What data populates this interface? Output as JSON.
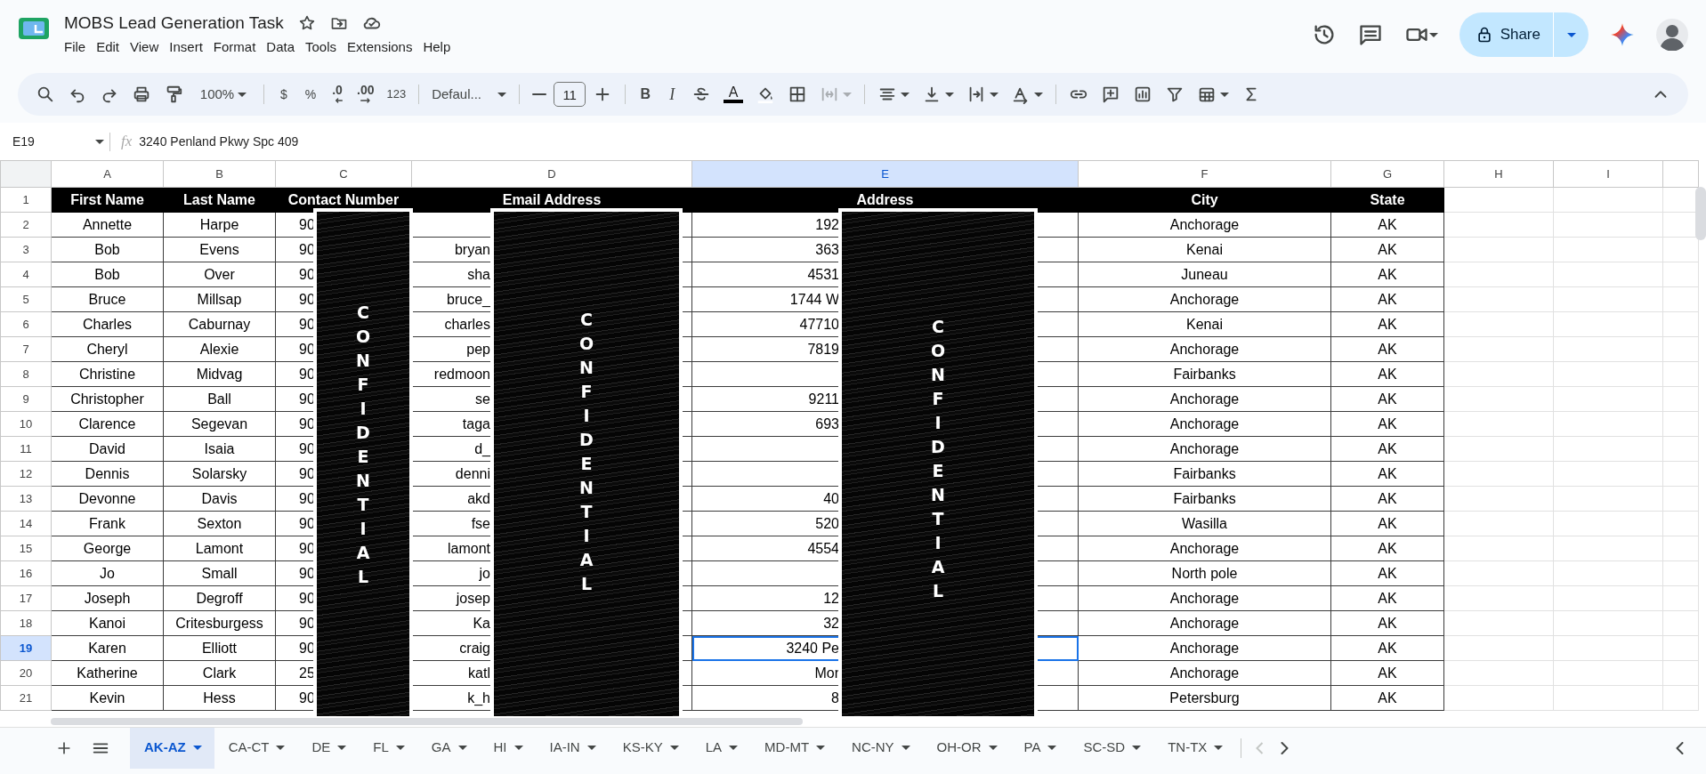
{
  "app": {
    "title": "MOBS Lead Generation Task",
    "menu": [
      "File",
      "Edit",
      "View",
      "Insert",
      "Format",
      "Data",
      "Tools",
      "Extensions",
      "Help"
    ],
    "share": "Share"
  },
  "toolbar": {
    "zoom": "100%",
    "currency": "$",
    "percent": "%",
    "decrease_decimal": ".0",
    "increase_decimal": ".00",
    "number_format": "123",
    "font": "Defaul...",
    "font_size": "11",
    "bold": "B",
    "italic": "I",
    "text_color": "A",
    "merge_disabled": true
  },
  "formula_bar": {
    "cell_ref": "E19",
    "fx": "fx",
    "value": "3240 Penland Pkwy Spc 409"
  },
  "sheet": {
    "header_row": "1",
    "columns": [
      {
        "letter": "A",
        "heading": "First Name",
        "selected": false
      },
      {
        "letter": "B",
        "heading": "Last Name",
        "selected": false
      },
      {
        "letter": "C",
        "heading": "Contact Number",
        "selected": false
      },
      {
        "letter": "D",
        "heading": "Email Address",
        "selected": false
      },
      {
        "letter": "E",
        "heading": "Address",
        "selected": true
      },
      {
        "letter": "F",
        "heading": "City",
        "selected": false
      },
      {
        "letter": "G",
        "heading": "State",
        "selected": false
      },
      {
        "letter": "H",
        "selected": false
      },
      {
        "letter": "I",
        "selected": false
      }
    ],
    "rows": [
      {
        "number": "2",
        "selected": false,
        "cells": {
          "first_name": "Annette",
          "last_name": "Harpe",
          "contact_number": "90",
          "address": "192",
          "city": "Anchorage",
          "state": "AK"
        }
      },
      {
        "number": "3",
        "selected": false,
        "cells": {
          "first_name": "Bob",
          "last_name": "Evens",
          "contact_number": "90",
          "email_address": "bryan",
          "address": "363",
          "city": "Kenai",
          "state": "AK"
        }
      },
      {
        "number": "4",
        "selected": false,
        "cells": {
          "first_name": "Bob",
          "last_name": "Over",
          "contact_number": "90",
          "email_address": "sha",
          "address": "4531",
          "city": "Juneau",
          "state": "AK"
        }
      },
      {
        "number": "5",
        "selected": false,
        "cells": {
          "first_name": "Bruce",
          "last_name": "Millsap",
          "contact_number": "90",
          "email_address": "bruce_",
          "address": "1744 W",
          "city": "Anchorage",
          "state": "AK"
        }
      },
      {
        "number": "6",
        "selected": false,
        "cells": {
          "first_name": "Charles",
          "last_name": "Caburnay",
          "contact_number": "90",
          "email_address": "charles",
          "address": "47710",
          "city": "Kenai",
          "state": "AK"
        }
      },
      {
        "number": "7",
        "selected": false,
        "cells": {
          "first_name": "Cheryl",
          "last_name": "Alexie",
          "contact_number": "90",
          "email_address": "pep",
          "address": "7819",
          "city": "Anchorage",
          "state": "AK"
        }
      },
      {
        "number": "8",
        "selected": false,
        "cells": {
          "first_name": "Christine",
          "last_name": "Midvag",
          "contact_number": "90",
          "email_address": "redmoon",
          "city": "Fairbanks",
          "state": "AK"
        }
      },
      {
        "number": "9",
        "selected": false,
        "cells": {
          "first_name": "Christopher",
          "last_name": "Ball",
          "contact_number": "90",
          "email_address": "se",
          "address": "9211",
          "city": "Anchorage",
          "state": "AK"
        }
      },
      {
        "number": "10",
        "selected": false,
        "cells": {
          "first_name": "Clarence",
          "last_name": "Segevan",
          "contact_number": "90",
          "email_address": "taga",
          "address": "693",
          "city": "Anchorage",
          "state": "AK"
        }
      },
      {
        "number": "11",
        "selected": false,
        "cells": {
          "first_name": "David",
          "last_name": "Isaia",
          "contact_number": "90",
          "email_address": "d_",
          "city": "Anchorage",
          "state": "AK"
        }
      },
      {
        "number": "12",
        "selected": false,
        "cells": {
          "first_name": "Dennis",
          "last_name": "Solarsky",
          "contact_number": "90",
          "email_address": "denni",
          "city": "Fairbanks",
          "state": "AK"
        }
      },
      {
        "number": "13",
        "selected": false,
        "cells": {
          "first_name": "Devonne",
          "last_name": "Davis",
          "contact_number": "90",
          "email_address": "akd",
          "address": "40",
          "city": "Fairbanks",
          "state": "AK"
        }
      },
      {
        "number": "14",
        "selected": false,
        "cells": {
          "first_name": "Frank",
          "last_name": "Sexton",
          "contact_number": "90",
          "email_address": "fse",
          "address": "520",
          "city": "Wasilla",
          "state": "AK"
        }
      },
      {
        "number": "15",
        "selected": false,
        "cells": {
          "first_name": "George",
          "last_name": "Lamont",
          "contact_number": "90",
          "email_address": "lamont",
          "address": "4554",
          "city": "Anchorage",
          "state": "AK"
        }
      },
      {
        "number": "16",
        "selected": false,
        "cells": {
          "first_name": "Jo",
          "last_name": "Small",
          "contact_number": "90",
          "email_address": "jo",
          "city": "North pole",
          "state": "AK"
        }
      },
      {
        "number": "17",
        "selected": false,
        "cells": {
          "first_name": "Joseph",
          "last_name": "Degroff",
          "contact_number": "90",
          "email_address": "josep",
          "address": "12",
          "city": "Anchorage",
          "state": "AK"
        }
      },
      {
        "number": "18",
        "selected": false,
        "cells": {
          "first_name": "Kanoi",
          "last_name": "Critesburgess",
          "contact_number": "90",
          "email_address": "Ka",
          "address": "32",
          "city": "Anchorage",
          "state": "AK"
        }
      },
      {
        "number": "19",
        "selected": true,
        "cells": {
          "first_name": "Karen",
          "last_name": "Elliott",
          "contact_number": "90",
          "email_address": "craig",
          "address": "3240 Pe",
          "city": "Anchorage",
          "state": "AK"
        }
      },
      {
        "number": "20",
        "selected": false,
        "cells": {
          "first_name": "Katherine",
          "last_name": "Clark",
          "contact_number": "25",
          "email_address": "katl",
          "address": "Mor",
          "city": "Anchorage",
          "state": "AK"
        }
      },
      {
        "number": "21",
        "selected": false,
        "cells": {
          "first_name": "Kevin",
          "last_name": "Hess",
          "contact_number": "90",
          "email_address": "k_h",
          "address": "8",
          "city": "Petersburg",
          "state": "AK"
        }
      }
    ],
    "redactions": [
      {
        "label": "CONFIDENTIAL"
      },
      {
        "label": "CONFIDENTIAL"
      },
      {
        "label": "CONFIDENTIAL"
      }
    ]
  },
  "sheet_tabs": [
    {
      "label": "AK-AZ",
      "selected": true
    },
    {
      "label": "CA-CT",
      "selected": false
    },
    {
      "label": "DE",
      "selected": false
    },
    {
      "label": "FL",
      "selected": false
    },
    {
      "label": "GA",
      "selected": false
    },
    {
      "label": "HI",
      "selected": false
    },
    {
      "label": "IA-IN",
      "selected": false
    },
    {
      "label": "KS-KY",
      "selected": false
    },
    {
      "label": "LA",
      "selected": false
    },
    {
      "label": "MD-MT",
      "selected": false
    },
    {
      "label": "NC-NY",
      "selected": false
    },
    {
      "label": "OH-OR",
      "selected": false
    },
    {
      "label": "PA",
      "selected": false
    },
    {
      "label": "SC-SD",
      "selected": false
    },
    {
      "label": "TN-TX",
      "selected": false
    }
  ]
}
